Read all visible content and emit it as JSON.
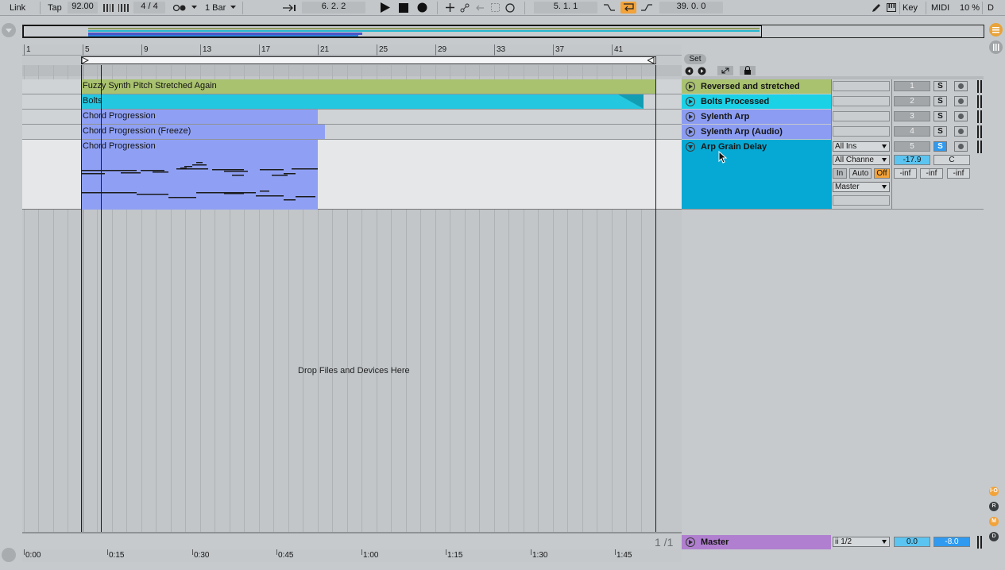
{
  "toolbar": {
    "link": "Link",
    "tap": "Tap",
    "tempo": "92.00",
    "time_sig": "4 / 4",
    "quantization": "1 Bar",
    "position": "6.  2.  2",
    "loop_start": "5.  1.  1",
    "loop_length": "39.  0.  0",
    "key": "Key",
    "midi": "MIDI",
    "cpu": "10 %",
    "d": "D"
  },
  "ruler": {
    "bars": [
      "1",
      "5",
      "9",
      "13",
      "17",
      "21",
      "25",
      "29",
      "33",
      "37",
      "41"
    ]
  },
  "set_button": "Set",
  "tracks": [
    {
      "name": "Reversed and stretched",
      "clip": "Fuzzy Synth Pitch Stretched Again",
      "number": "1",
      "solo": "S",
      "color": "#a9c26f",
      "clip_color": "#a9c26f"
    },
    {
      "name": "Bolts Processed",
      "clip": "Bolts",
      "number": "2",
      "solo": "S",
      "color": "#1ad1e6",
      "clip_color": "#24c7e0"
    },
    {
      "name": "Sylenth Arp",
      "clip": "Chord Progression",
      "number": "3",
      "solo": "S",
      "color": "#8b9cf2",
      "clip_color": "#8fa0f4"
    },
    {
      "name": "Sylenth Arp (Audio)",
      "clip": "Chord Progression (Freeze)",
      "number": "4",
      "solo": "S",
      "color": "#8b9cf2",
      "clip_color": "#8fa0f4"
    },
    {
      "name": "Arp Grain Delay",
      "clip": "Chord Progression",
      "number": "5",
      "solo": "S",
      "color": "#06a9d4",
      "clip_color": "#8fa0f4"
    }
  ],
  "expanded_track": {
    "input_type": "All Ins",
    "input_channel": "All Channe",
    "monitor_in": "In",
    "monitor_auto": "Auto",
    "monitor_off": "Off",
    "output": "Master",
    "volume": "-17.9",
    "pan": "C",
    "sends": [
      "-inf",
      "-inf",
      "-inf"
    ]
  },
  "drop_text": "Drop Files and Devices Here",
  "zoom_page": "1 /1",
  "master": {
    "name": "Master",
    "output": "ii 1/2",
    "volume": "0.0",
    "level": "-8.0",
    "color": "#b07fcf"
  },
  "timeline": [
    "0:00",
    "0:15",
    "0:30",
    "0:45",
    "1:00",
    "1:15",
    "1:30",
    "1:45"
  ],
  "side_buttons": [
    "I·O",
    "R",
    "M",
    "D"
  ]
}
